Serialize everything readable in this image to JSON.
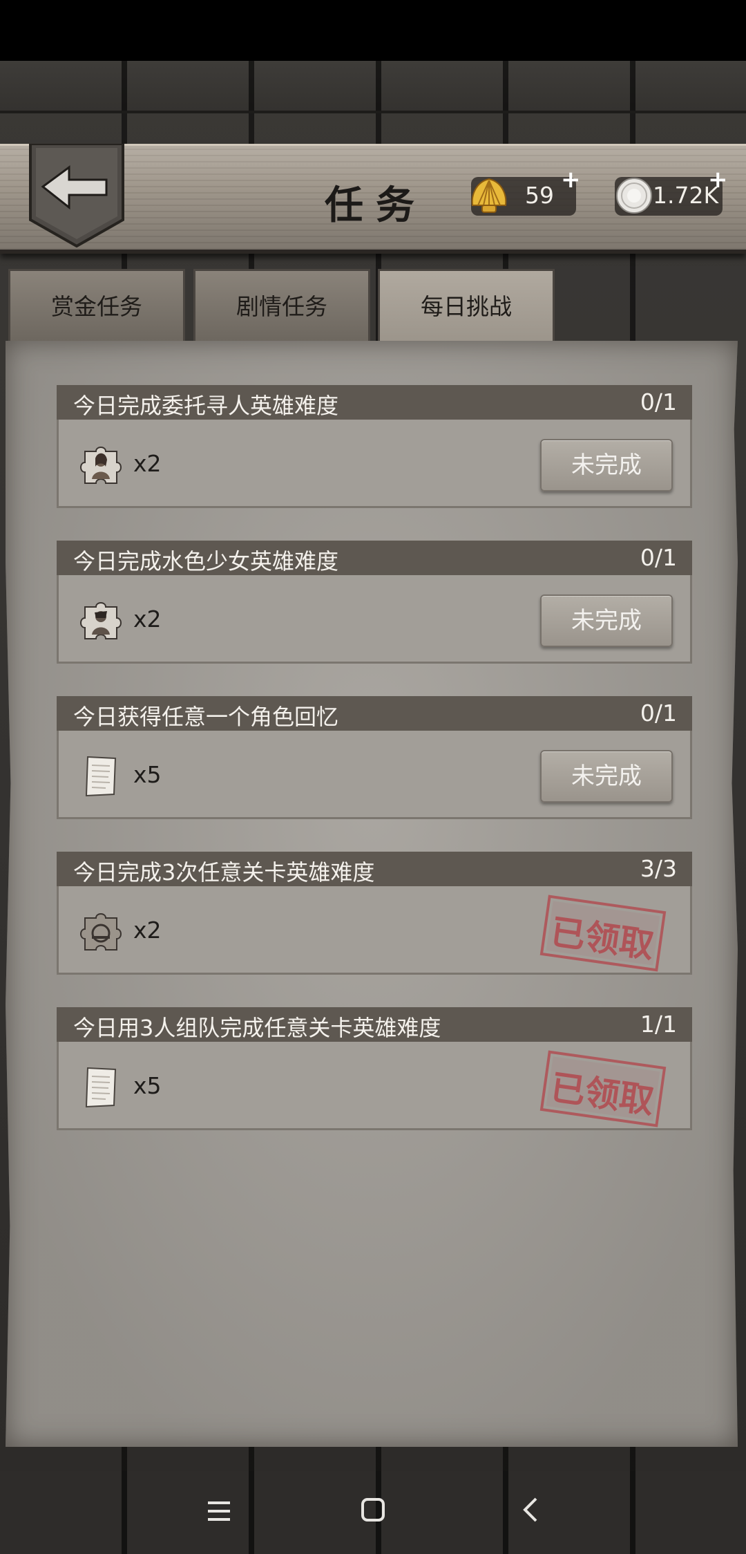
{
  "header": {
    "title": "任务",
    "shell_value": "59",
    "coin_value": "1.72K",
    "plus": "+"
  },
  "tabs": [
    {
      "label": "赏金任务",
      "active": false
    },
    {
      "label": "剧情任务",
      "active": false
    },
    {
      "label": "每日挑战",
      "active": true
    }
  ],
  "tasks": [
    {
      "title": "今日完成委托寻人英雄难度",
      "progress": "0/1",
      "reward_icon": "puzzle-portrait-icon",
      "qty": "x2",
      "status": "未完成"
    },
    {
      "title": "今日完成水色少女英雄难度",
      "progress": "0/1",
      "reward_icon": "puzzle-portrait-icon",
      "qty": "x2",
      "status": "未完成"
    },
    {
      "title": "今日获得任意一个角色回忆",
      "progress": "0/1",
      "reward_icon": "paper-scroll-icon",
      "qty": "x5",
      "status": "未完成"
    },
    {
      "title": "今日完成3次任意关卡英雄难度",
      "progress": "3/3",
      "reward_icon": "puzzle-emblem-icon",
      "qty": "x2",
      "status": "已领取"
    },
    {
      "title": "今日用3人组队完成任意关卡英雄难度",
      "progress": "1/1",
      "reward_icon": "paper-scroll-icon",
      "qty": "x5",
      "status": "已领取"
    }
  ],
  "colors": {
    "panel": "#a5a19b",
    "task_header": "#5e5851",
    "stamp": "#b2434a"
  }
}
